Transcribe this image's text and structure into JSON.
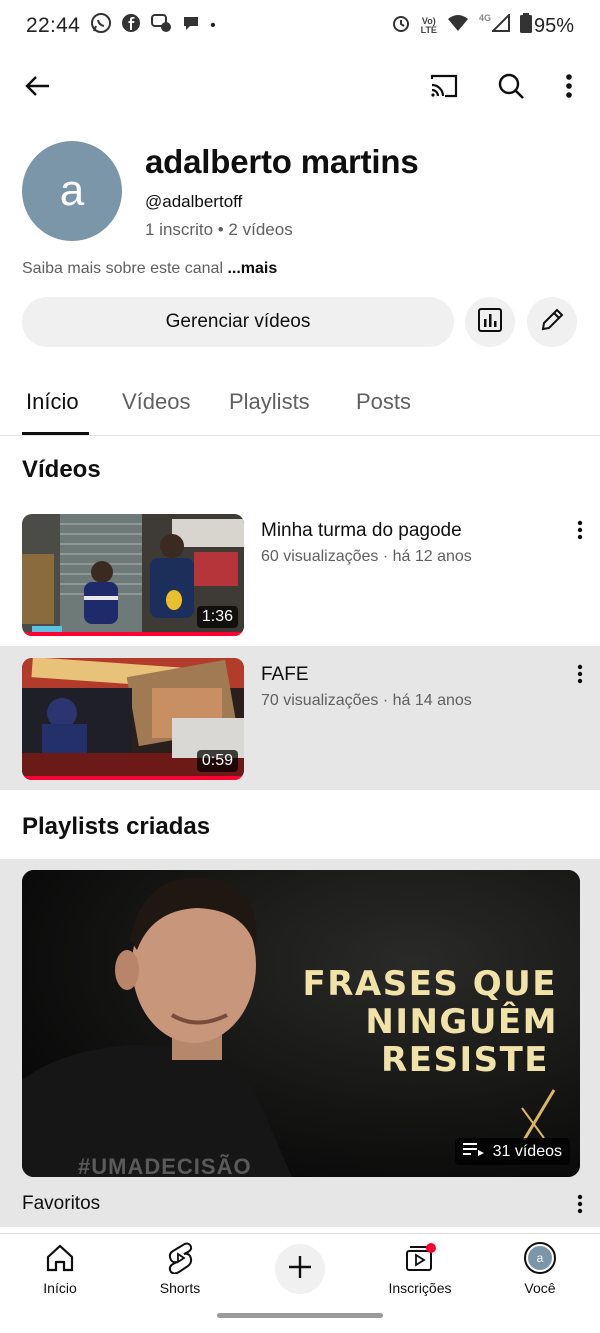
{
  "status_bar": {
    "time": "22:44",
    "dot": "•",
    "network_small_top": "Vo)",
    "network_small_bottom": "LTE",
    "network_type": "4G",
    "battery": "95%",
    "icons": [
      "whatsapp-icon",
      "facebook-icon",
      "messenger-icon",
      "chat-icon",
      "alarm-icon",
      "wifi-icon",
      "signal-icon",
      "battery-icon"
    ]
  },
  "appbar": {
    "icons": [
      "back-arrow-icon",
      "cast-icon",
      "search-icon",
      "more-vert-icon"
    ]
  },
  "channel": {
    "avatar_letter": "a",
    "name": "adalberto martins",
    "handle": "@adalbertoff",
    "meta": "1 inscrito • 2 vídeos",
    "about": "Saiba mais sobre este canal",
    "about_more": " ...mais",
    "manage_button": "Gerenciar vídeos"
  },
  "tabs": [
    {
      "label": "Início",
      "active": true
    },
    {
      "label": "Vídeos",
      "active": false
    },
    {
      "label": "Playlists",
      "active": false
    },
    {
      "label": "Posts",
      "active": false
    }
  ],
  "sections": {
    "videos_title": "Vídeos",
    "playlists_title": "Playlists criadas"
  },
  "videos": [
    {
      "title": "Minha turma do pagode",
      "meta": "60 visualizações · há 12 anos",
      "duration": "1:36"
    },
    {
      "title": "FAFE",
      "meta": "70 visualizações · há 14 anos",
      "duration": "0:59"
    }
  ],
  "playlist": {
    "name": "Favoritos",
    "count": "31 vídeos",
    "thumb_text": [
      "FRASES QUE",
      "NINGUÊM",
      "RESISTE"
    ],
    "shirt_text": "#UMADECISÃO"
  },
  "bottom_nav": [
    {
      "label": "Início",
      "icon": "home-icon"
    },
    {
      "label": "Shorts",
      "icon": "shorts-icon"
    },
    {
      "label": "",
      "icon": "add-icon"
    },
    {
      "label": "Inscrições",
      "icon": "subscriptions-icon"
    },
    {
      "label": "Você",
      "icon": "avatar-icon",
      "avatar_letter": "a"
    }
  ],
  "colors": {
    "accent_red": "#ff0033",
    "avatar_bg": "#7b96a8",
    "button_bg": "#f0f0f0",
    "secondary_text": "#606060",
    "playlist_title_gold": "#f1e3a8"
  }
}
